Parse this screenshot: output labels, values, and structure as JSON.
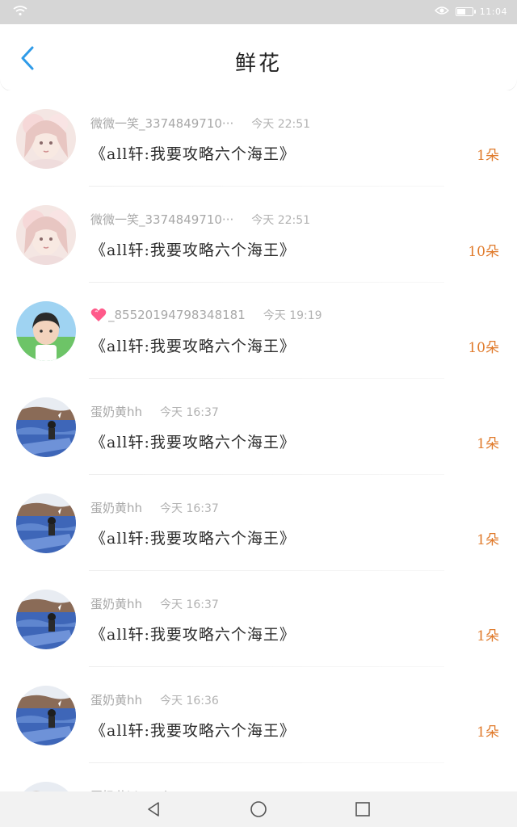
{
  "status_bar": {
    "time": "11:04",
    "battery_level": 0.6,
    "wifi_icon": "wifi-icon",
    "eye_icon": "eye-icon"
  },
  "header": {
    "title": "鲜花",
    "back_icon": "chevron-left-icon",
    "accent": "#2f9be8"
  },
  "colors": {
    "count": "#e07b2c",
    "name": "#a8a8a8",
    "title": "#2d2d2d"
  },
  "gifts": [
    {
      "name": "微微一笑_3374849710···",
      "time": "今天 22:51",
      "book": "《all轩:我要攻略六个海王》",
      "count": "1朵",
      "avatar": "girl-avatar"
    },
    {
      "name": "微微一笑_3374849710···",
      "time": "今天 22:51",
      "book": "《all轩:我要攻略六个海王》",
      "count": "10朵",
      "avatar": "girl-avatar"
    },
    {
      "name": "_85520194798348181",
      "time": "今天 19:19",
      "book": "《all轩:我要攻略六个海王》",
      "count": "10朵",
      "avatar": "boy-avatar",
      "heart": true
    },
    {
      "name": "蛋奶黄hh",
      "time": "今天 16:37",
      "book": "《all轩:我要攻略六个海王》",
      "count": "1朵",
      "avatar": "sea-avatar"
    },
    {
      "name": "蛋奶黄hh",
      "time": "今天 16:37",
      "book": "《all轩:我要攻略六个海王》",
      "count": "1朵",
      "avatar": "sea-avatar"
    },
    {
      "name": "蛋奶黄hh",
      "time": "今天 16:37",
      "book": "《all轩:我要攻略六个海王》",
      "count": "1朵",
      "avatar": "sea-avatar"
    },
    {
      "name": "蛋奶黄hh",
      "time": "今天 16:36",
      "book": "《all轩:我要攻略六个海王》",
      "count": "1朵",
      "avatar": "sea-avatar"
    },
    {
      "name": "蛋奶黄hh",
      "time": "今天",
      "book": "",
      "count": "",
      "avatar": "sea-avatar"
    }
  ],
  "nav": {
    "back": "triangle-back-icon",
    "home": "circle-home-icon",
    "recents": "square-recents-icon"
  }
}
